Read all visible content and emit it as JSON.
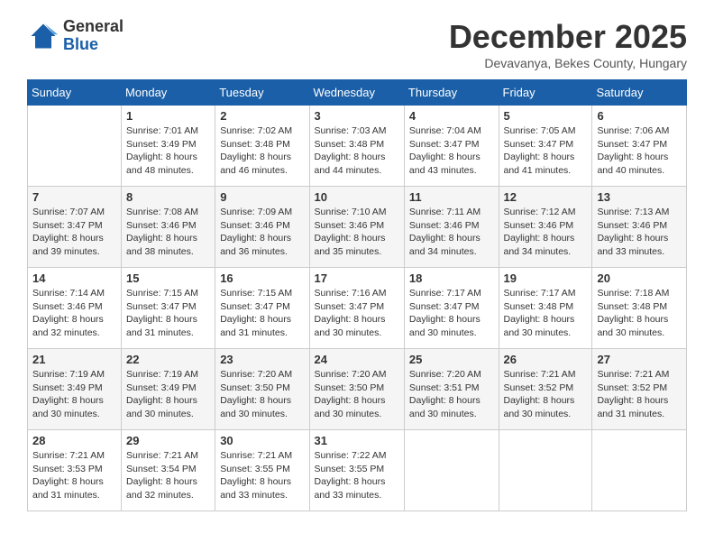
{
  "header": {
    "logo_general": "General",
    "logo_blue": "Blue",
    "month_title": "December 2025",
    "subtitle": "Devavanya, Bekes County, Hungary"
  },
  "days_of_week": [
    "Sunday",
    "Monday",
    "Tuesday",
    "Wednesday",
    "Thursday",
    "Friday",
    "Saturday"
  ],
  "weeks": [
    [
      {
        "day": "",
        "info": ""
      },
      {
        "day": "1",
        "info": "Sunrise: 7:01 AM\nSunset: 3:49 PM\nDaylight: 8 hours\nand 48 minutes."
      },
      {
        "day": "2",
        "info": "Sunrise: 7:02 AM\nSunset: 3:48 PM\nDaylight: 8 hours\nand 46 minutes."
      },
      {
        "day": "3",
        "info": "Sunrise: 7:03 AM\nSunset: 3:48 PM\nDaylight: 8 hours\nand 44 minutes."
      },
      {
        "day": "4",
        "info": "Sunrise: 7:04 AM\nSunset: 3:47 PM\nDaylight: 8 hours\nand 43 minutes."
      },
      {
        "day": "5",
        "info": "Sunrise: 7:05 AM\nSunset: 3:47 PM\nDaylight: 8 hours\nand 41 minutes."
      },
      {
        "day": "6",
        "info": "Sunrise: 7:06 AM\nSunset: 3:47 PM\nDaylight: 8 hours\nand 40 minutes."
      }
    ],
    [
      {
        "day": "7",
        "info": "Sunrise: 7:07 AM\nSunset: 3:47 PM\nDaylight: 8 hours\nand 39 minutes."
      },
      {
        "day": "8",
        "info": "Sunrise: 7:08 AM\nSunset: 3:46 PM\nDaylight: 8 hours\nand 38 minutes."
      },
      {
        "day": "9",
        "info": "Sunrise: 7:09 AM\nSunset: 3:46 PM\nDaylight: 8 hours\nand 36 minutes."
      },
      {
        "day": "10",
        "info": "Sunrise: 7:10 AM\nSunset: 3:46 PM\nDaylight: 8 hours\nand 35 minutes."
      },
      {
        "day": "11",
        "info": "Sunrise: 7:11 AM\nSunset: 3:46 PM\nDaylight: 8 hours\nand 34 minutes."
      },
      {
        "day": "12",
        "info": "Sunrise: 7:12 AM\nSunset: 3:46 PM\nDaylight: 8 hours\nand 34 minutes."
      },
      {
        "day": "13",
        "info": "Sunrise: 7:13 AM\nSunset: 3:46 PM\nDaylight: 8 hours\nand 33 minutes."
      }
    ],
    [
      {
        "day": "14",
        "info": "Sunrise: 7:14 AM\nSunset: 3:46 PM\nDaylight: 8 hours\nand 32 minutes."
      },
      {
        "day": "15",
        "info": "Sunrise: 7:15 AM\nSunset: 3:47 PM\nDaylight: 8 hours\nand 31 minutes."
      },
      {
        "day": "16",
        "info": "Sunrise: 7:15 AM\nSunset: 3:47 PM\nDaylight: 8 hours\nand 31 minutes."
      },
      {
        "day": "17",
        "info": "Sunrise: 7:16 AM\nSunset: 3:47 PM\nDaylight: 8 hours\nand 30 minutes."
      },
      {
        "day": "18",
        "info": "Sunrise: 7:17 AM\nSunset: 3:47 PM\nDaylight: 8 hours\nand 30 minutes."
      },
      {
        "day": "19",
        "info": "Sunrise: 7:17 AM\nSunset: 3:48 PM\nDaylight: 8 hours\nand 30 minutes."
      },
      {
        "day": "20",
        "info": "Sunrise: 7:18 AM\nSunset: 3:48 PM\nDaylight: 8 hours\nand 30 minutes."
      }
    ],
    [
      {
        "day": "21",
        "info": "Sunrise: 7:19 AM\nSunset: 3:49 PM\nDaylight: 8 hours\nand 30 minutes."
      },
      {
        "day": "22",
        "info": "Sunrise: 7:19 AM\nSunset: 3:49 PM\nDaylight: 8 hours\nand 30 minutes."
      },
      {
        "day": "23",
        "info": "Sunrise: 7:20 AM\nSunset: 3:50 PM\nDaylight: 8 hours\nand 30 minutes."
      },
      {
        "day": "24",
        "info": "Sunrise: 7:20 AM\nSunset: 3:50 PM\nDaylight: 8 hours\nand 30 minutes."
      },
      {
        "day": "25",
        "info": "Sunrise: 7:20 AM\nSunset: 3:51 PM\nDaylight: 8 hours\nand 30 minutes."
      },
      {
        "day": "26",
        "info": "Sunrise: 7:21 AM\nSunset: 3:52 PM\nDaylight: 8 hours\nand 30 minutes."
      },
      {
        "day": "27",
        "info": "Sunrise: 7:21 AM\nSunset: 3:52 PM\nDaylight: 8 hours\nand 31 minutes."
      }
    ],
    [
      {
        "day": "28",
        "info": "Sunrise: 7:21 AM\nSunset: 3:53 PM\nDaylight: 8 hours\nand 31 minutes."
      },
      {
        "day": "29",
        "info": "Sunrise: 7:21 AM\nSunset: 3:54 PM\nDaylight: 8 hours\nand 32 minutes."
      },
      {
        "day": "30",
        "info": "Sunrise: 7:21 AM\nSunset: 3:55 PM\nDaylight: 8 hours\nand 33 minutes."
      },
      {
        "day": "31",
        "info": "Sunrise: 7:22 AM\nSunset: 3:55 PM\nDaylight: 8 hours\nand 33 minutes."
      },
      {
        "day": "",
        "info": ""
      },
      {
        "day": "",
        "info": ""
      },
      {
        "day": "",
        "info": ""
      }
    ]
  ]
}
